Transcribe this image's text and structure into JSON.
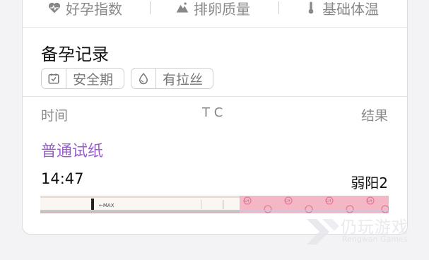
{
  "tabs": [
    {
      "label": "好孕指数",
      "icon": "heart-pulse-icon"
    },
    {
      "label": "排卵质量",
      "icon": "mountain-icon"
    },
    {
      "label": "基础体温",
      "icon": "thermometer-icon"
    }
  ],
  "record": {
    "title": "备孕记录",
    "tags": [
      {
        "label": "安全期",
        "icon": "calendar-check-icon"
      },
      {
        "label": "有拉丝",
        "icon": "droplet-icon"
      }
    ]
  },
  "table": {
    "headers": {
      "time": "时间",
      "tc": "T C",
      "result": "结果"
    },
    "entry": {
      "type": "普通试纸",
      "time": "14:47",
      "result": "弱阳2",
      "strip_max_label": "←MAX",
      "strip_brand_text": "LH"
    }
  },
  "watermark": {
    "text": "仍玩游戏",
    "sub": "Rengwan Games"
  },
  "colors": {
    "accent_purple": "#9a5fc9",
    "strip_pink": "#f3b7c6"
  }
}
